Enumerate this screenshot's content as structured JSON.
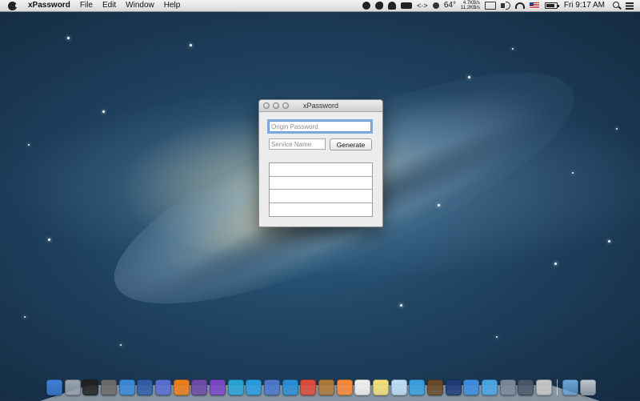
{
  "menubar": {
    "app_name": "xPassword",
    "menus": [
      "File",
      "Edit",
      "Window",
      "Help"
    ],
    "status": {
      "temperature": "64°",
      "upload_speed": "4.7KB/s",
      "download_speed": "11.2KB/s",
      "battery_level": 0.85,
      "clock": "Fri 9:17 AM"
    }
  },
  "window": {
    "title": "xPassword",
    "origin_password_placeholder": "Origin Password",
    "service_name_placeholder": "Service Name",
    "generate_label": "Generate",
    "result_rows": [
      "",
      "",
      "",
      ""
    ]
  },
  "dock": {
    "icon_colors": [
      "#3f7fd6",
      "#9aa3ad",
      "#222222",
      "#6b6b6b",
      "#3b8ad8",
      "#2f5fa8",
      "#5a6ed0",
      "#ef7f1a",
      "#6e4aa8",
      "#7b47c6",
      "#2aa6d8",
      "#2a9ee0",
      "#4a78c8",
      "#2a8fd8",
      "#e04b3a",
      "#b07a3a",
      "#ff8a3a",
      "#f2f2f2",
      "#f6e27a",
      "#bfe0f6",
      "#3aa0e0",
      "#6a4a2a",
      "#1f3c7a",
      "#3f8ee0",
      "#4aa6e6",
      "#7a8a9a",
      "#4a5a6a",
      "#c8c8c8"
    ],
    "stack_colors": [
      "#6aa6d8",
      "#c0c6cc"
    ]
  }
}
